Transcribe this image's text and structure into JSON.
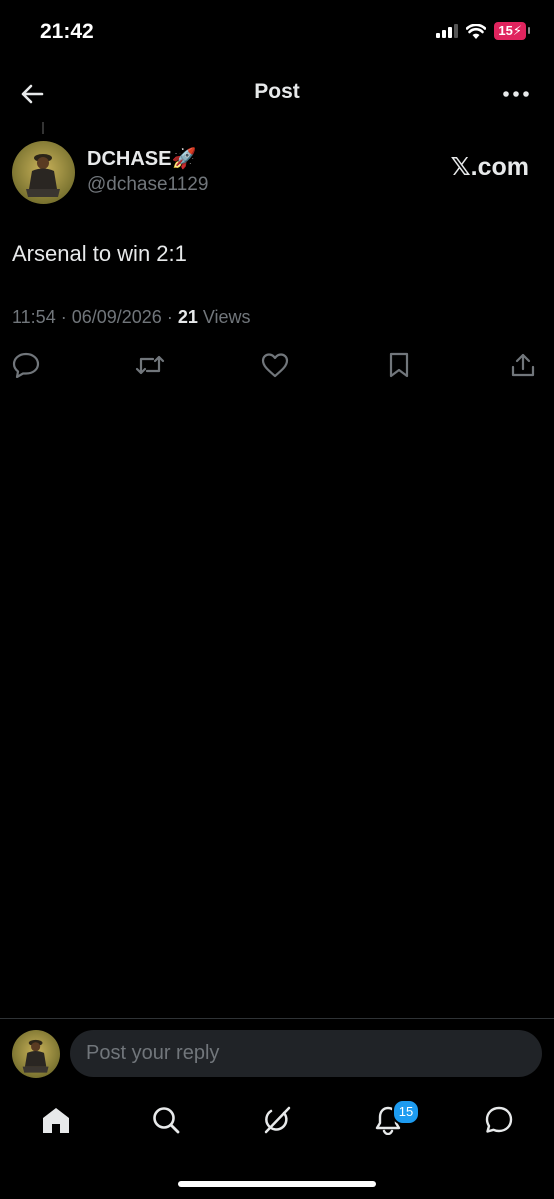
{
  "status_bar": {
    "time": "21:42",
    "battery": "15",
    "icons": [
      "signal-icon",
      "wifi-icon",
      "battery-charging-icon"
    ]
  },
  "header": {
    "title": "Post",
    "back_icon": "arrow-left-icon",
    "more_icon": "more-horizontal-icon"
  },
  "post": {
    "author": {
      "display_name": "DCHASE",
      "name_emoji": "🚀",
      "handle": "@dchase1129"
    },
    "source_label": "𝕏.com",
    "text": "Arsenal to win 2:1",
    "time": "11:54",
    "date": "06/09/2026",
    "separator": "·",
    "views_count": "21",
    "views_label": "Views",
    "actions": [
      "reply-icon",
      "repost-icon",
      "like-icon",
      "bookmark-icon",
      "share-icon"
    ]
  },
  "reply": {
    "placeholder": "Post your reply"
  },
  "tab_bar": {
    "tabs": [
      "home-icon",
      "search-icon",
      "grok-icon",
      "notifications-icon",
      "messages-icon"
    ],
    "notification_badge": "15"
  },
  "colors": {
    "background": "#000000",
    "text": "#e7e9ea",
    "muted": "#71767b",
    "accent": "#1d9bf0",
    "battery_low": "#e0245e"
  }
}
